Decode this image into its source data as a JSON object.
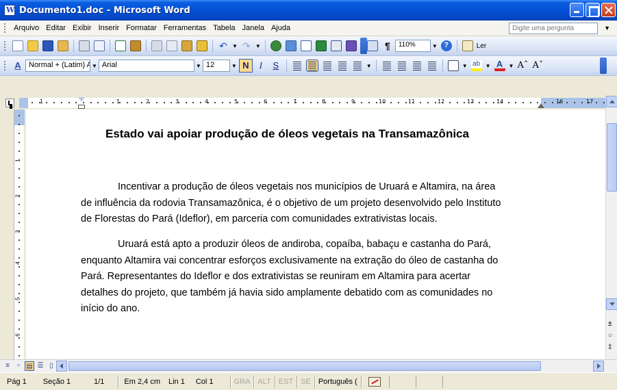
{
  "window": {
    "title": "Documento1.doc - Microsoft Word"
  },
  "menu": {
    "items": [
      {
        "label": "Arquivo"
      },
      {
        "label": "Editar"
      },
      {
        "label": "Exibir"
      },
      {
        "label": "Inserir"
      },
      {
        "label": "Formatar"
      },
      {
        "label": "Ferramentas"
      },
      {
        "label": "Tabela"
      },
      {
        "label": "Janela"
      },
      {
        "label": "Ajuda"
      }
    ],
    "help_placeholder": "Digite uma pergunta"
  },
  "standard_toolbar": {
    "zoom": "110%",
    "read_label": "Ler",
    "icons": [
      "new-document-icon",
      "open-folder-icon",
      "save-disk-icon",
      "permission-icon",
      "print-icon",
      "print-preview-icon",
      "spelling-icon",
      "research-icon",
      "cut-icon",
      "copy-icon",
      "paste-icon",
      "format-painter-icon",
      "undo-icon",
      "redo-icon",
      "hyperlink-icon",
      "tables-borders-icon",
      "insert-table-icon",
      "insert-excel-icon",
      "columns-icon",
      "drawing-icon",
      "document-map-icon",
      "pilcrow-icon",
      "help-icon",
      "read-icon"
    ]
  },
  "formatting_toolbar": {
    "style": "Normal + (Latim) Ari",
    "font": "Arial",
    "size": "12",
    "bold": "N",
    "italic": "I",
    "underline": "S",
    "active_alignment": "center"
  },
  "ruler": {
    "numbers": [
      "1",
      "1",
      "2",
      "3",
      "4",
      "5",
      "6",
      "7",
      "8",
      "9",
      "10",
      "11",
      "12",
      "13",
      "14",
      "16",
      "17"
    ],
    "vertical_numbers": [
      "1",
      "2",
      "3",
      "4",
      "5",
      "6"
    ]
  },
  "document": {
    "title": "Estado vai apoiar produção de óleos vegetais na Transamazônica",
    "paragraphs": [
      {
        "lines": [
          "Incentivar a produção de óleos vegetais nos municípios de Uruará e Altamira, na área",
          "de influência da rodovia Transamazônica, é o objetivo de um projeto desenvolvido pelo Instituto",
          "de Florestas do Pará (Ideflor), em parceria com comunidades extrativistas locais."
        ]
      },
      {
        "lines": [
          "Uruará está apto a produzir óleos de andiroba, copaíba, babaçu e castanha do Pará,",
          "enquanto Altamira vai concentrar esforços exclusivamente na extração do óleo de castanha do",
          "Pará. Representantes do Ideflor e dos extrativistas se reuniram em Altamira para acertar",
          "detalhes do projeto, que também já havia sido amplamente debatido com as comunidades no",
          "início do ano."
        ]
      }
    ]
  },
  "statusbar": {
    "page": "Pág 1",
    "section": "Seção 1",
    "page_of": "1/1",
    "position": "Em 2,4 cm",
    "line": "Lin 1",
    "column": "Col 1",
    "rec": "GRA",
    "trk": "ALT",
    "ext": "EST",
    "ovr": "SE",
    "language": "Português ("
  },
  "colors": {
    "titlebar": "#0551d6",
    "toolbar": "#dce6f7",
    "active_button": "#fbd98d"
  }
}
